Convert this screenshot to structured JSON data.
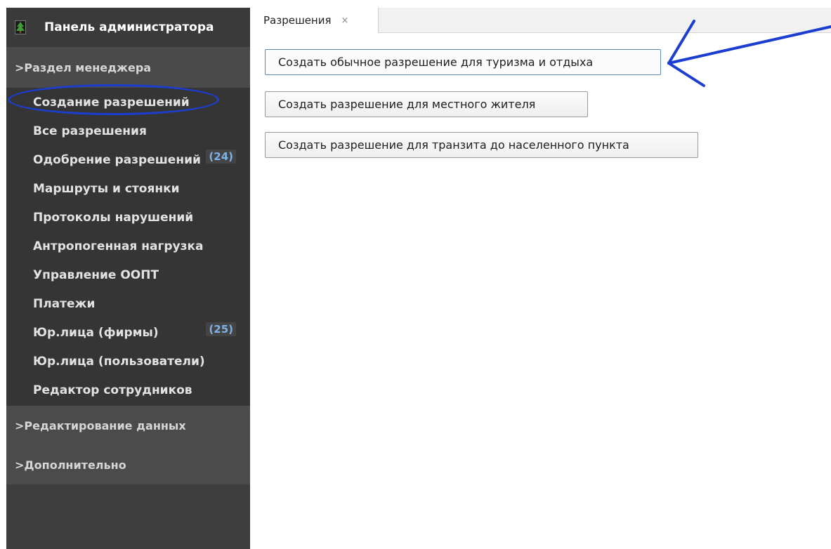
{
  "sidebar": {
    "title": "Панель администратора",
    "logo_icon": "tree-logo-icon",
    "manager_section": ">Раздел менеджера",
    "items": [
      {
        "label": "Создание разрешений",
        "badge": ""
      },
      {
        "label": "Все разрешения",
        "badge": ""
      },
      {
        "label": "Одобрение разрешений",
        "badge": "(24)"
      },
      {
        "label": "Маршруты и стоянки",
        "badge": ""
      },
      {
        "label": "Протоколы нарушений",
        "badge": ""
      },
      {
        "label": "Антропогенная нагрузка",
        "badge": ""
      },
      {
        "label": "Управление ООПТ",
        "badge": ""
      },
      {
        "label": "Платежи",
        "badge": ""
      },
      {
        "label": "Юр.лица (фирмы)",
        "badge": "(25)"
      },
      {
        "label": "Юр.лица (пользователи)",
        "badge": ""
      },
      {
        "label": "Редактор сотрудников",
        "badge": ""
      }
    ],
    "data_section": ">Редактирование данных",
    "extra_section": ">Дополнительно"
  },
  "tabs": [
    {
      "label": "Разрешения",
      "close": "×"
    }
  ],
  "buttons": {
    "tourism": "Создать обычное разрешение для туризма и отдыха",
    "resident": "Создать разрешение для местного жителя",
    "transit": "Создать разрешение для транзита до населенного пункта"
  },
  "colors": {
    "sidebar_bg": "#3e3e3e",
    "annotation": "#1c3ed0",
    "badge": "#7fb2e6"
  }
}
